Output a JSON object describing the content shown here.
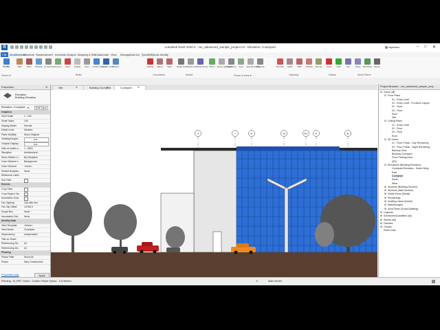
{
  "titlebar": {
    "title": "Autodesk Revit 2020.2 - rac_advanced_sample_project.rvt - Elevation: Courtyard",
    "user": "szpieska"
  },
  "menu": {
    "file": "File",
    "items": [
      "Architecture",
      "Structure",
      "Systems",
      "Insert",
      "Annotate",
      "Analyze",
      "Massing & Site",
      "Collaborate",
      "View",
      "Manage",
      "Add-Ins",
      "Quick",
      "BIMtools",
      "Modify"
    ]
  },
  "ribbon": {
    "modify": "Modify",
    "select": "Select ▾",
    "build_tools": [
      "Wall",
      "Door",
      "Window",
      "Component",
      "Column",
      "Roof",
      "Ceiling",
      "Floor",
      "Curtain System",
      "Curtain Grid",
      "Mullion"
    ],
    "circulation_tools": [
      "Railing",
      "Ramp",
      "Stair"
    ],
    "model_tools": [
      "Model Text",
      "Model Line",
      "Model Group"
    ],
    "room_tools": [
      "Room",
      "Room Separator",
      "Tag Room",
      "Area",
      "Area Boundary",
      "Tag Area"
    ],
    "opening_tools": [
      "By Face",
      "Shaft",
      "Wall",
      "Vertical",
      "Dormer"
    ],
    "datum_tools": [
      "Level",
      "Grid"
    ],
    "workplane_tools": [
      "Set",
      "Show",
      "Ref Plane",
      "Viewer"
    ],
    "panels": [
      "Build",
      "Circulation",
      "Model",
      "Room & Area ▾",
      "Opening",
      "Datum",
      "Work Plane"
    ]
  },
  "properties": {
    "title": "Properties",
    "type_name": "Elevation",
    "type_sub": "Building Elevation",
    "selector": "Elevation: Courtyard",
    "edit_type": "Edit Type",
    "rows": [
      {
        "k": "Graphics",
        "v": "",
        "grp": true
      },
      {
        "k": "View Scale",
        "v": "1 : 100"
      },
      {
        "k": "Scale Value",
        "v": "100"
      },
      {
        "k": "Display Model",
        "v": "Normal"
      },
      {
        "k": "Detail Level",
        "v": "Medium"
      },
      {
        "k": "Parts Visibility",
        "v": "Show Original"
      },
      {
        "k": "Visibility/Graphi...",
        "v": "Edit...",
        "btn": true
      },
      {
        "k": "Graphic Display ...",
        "v": "Edit...",
        "btn": true
      },
      {
        "k": "Hide at scales c...",
        "v": "1 : 5000"
      },
      {
        "k": "Discipline",
        "v": "Architectural"
      },
      {
        "k": "Show Hidden Li...",
        "v": "By Discipline"
      },
      {
        "k": "Color Scheme L...",
        "v": "Background"
      },
      {
        "k": "Color Scheme",
        "v": "<none>"
      },
      {
        "k": "Default Analysis...",
        "v": "None"
      },
      {
        "k": "Reference Label",
        "v": ""
      },
      {
        "k": "Sun Path",
        "v": "",
        "cb": true
      },
      {
        "k": "Extents",
        "v": "",
        "grp": true
      },
      {
        "k": "Crop View",
        "v": "",
        "cb": true
      },
      {
        "k": "Crop Region Vis...",
        "v": "",
        "cb": true
      },
      {
        "k": "Annotation Crop",
        "v": "",
        "cb": true
      },
      {
        "k": "Far Clipping",
        "v": "Clip with line"
      },
      {
        "k": "Far Clip Offset",
        "v": "14756.3"
      },
      {
        "k": "Scope Box",
        "v": "None"
      },
      {
        "k": "Associated Dat...",
        "v": "None"
      },
      {
        "k": "Identity Data",
        "v": "",
        "grp": true
      },
      {
        "k": "View Template",
        "v": "<None>"
      },
      {
        "k": "View Name",
        "v": "Courtyard"
      },
      {
        "k": "Dependency",
        "v": "Independent"
      },
      {
        "k": "Title on Sheet",
        "v": ""
      },
      {
        "k": "Referencing Sh...",
        "v": "A1"
      },
      {
        "k": "Referencing De...",
        "v": "A1"
      },
      {
        "k": "Phasing",
        "v": "",
        "grp": true
      },
      {
        "k": "Phase Filter",
        "v": "Show All"
      },
      {
        "k": "Phase",
        "v": "New Construction"
      }
    ],
    "help": "Properties help",
    "apply": "Apply"
  },
  "view_tabs": [
    {
      "label": "Site",
      "active": false
    },
    {
      "label": "Building Courtyard",
      "active": false
    },
    {
      "label": "Courtyard",
      "active": true
    }
  ],
  "grid_labels": [
    "J",
    "I",
    "H",
    "G",
    "F1",
    "F",
    "E"
  ],
  "view_control": {
    "scale": "1 : 100"
  },
  "project_browser": {
    "title": "Project Browser - rac_advanced_sample_proj...",
    "items": [
      {
        "t": "Views (all)",
        "d": 0,
        "exp": "-"
      },
      {
        "t": "Floor Plans",
        "d": 1,
        "exp": "-"
      },
      {
        "t": "01 - Entry Level",
        "d": 2
      },
      {
        "t": "01 - Entry Level - Furniture Layout",
        "d": 2
      },
      {
        "t": "02 - Floor",
        "d": 2
      },
      {
        "t": "03 - Floor",
        "d": 2
      },
      {
        "t": "Roof",
        "d": 2
      },
      {
        "t": "Site",
        "d": 2
      },
      {
        "t": "Ceiling Plans",
        "d": 1,
        "exp": "-"
      },
      {
        "t": "01 - Entry Level",
        "d": 2
      },
      {
        "t": "02 - Floor",
        "d": 2
      },
      {
        "t": "03 - Floor",
        "d": 2
      },
      {
        "t": "Roof",
        "d": 2
      },
      {
        "t": "3D Views",
        "d": 1,
        "exp": "-"
      },
      {
        "t": "01 - Floor Public - Day Rendering",
        "d": 2
      },
      {
        "t": "03 - Floor Public - Night Rendering",
        "d": 2
      },
      {
        "t": "Balcony View",
        "d": 2
      },
      {
        "t": "Building Courtyard",
        "d": 2
      },
      {
        "t": "From Parking Area",
        "d": 2
      },
      {
        "t": "{3D}",
        "d": 2
      },
      {
        "t": "Elevations (Building Elevation)",
        "d": 1,
        "exp": "-"
      },
      {
        "t": "Courtyard Elevation - South Wing",
        "d": 2
      },
      {
        "t": "East",
        "d": 2
      },
      {
        "t": "Courtyard",
        "d": 2,
        "sel": true
      },
      {
        "t": "South",
        "d": 2
      },
      {
        "t": "West",
        "d": 2
      },
      {
        "t": "Sections (Building Section)",
        "d": 1,
        "exp": "+"
      },
      {
        "t": "Sections (Wall Section)",
        "d": 1,
        "exp": "+"
      },
      {
        "t": "Detail Views (Detail)",
        "d": 1,
        "exp": "+"
      },
      {
        "t": "Renderings",
        "d": 1,
        "exp": "+"
      },
      {
        "t": "Drafting Views (Detail)",
        "d": 1,
        "exp": "+"
      },
      {
        "t": "Walkthroughs",
        "d": 1,
        "exp": "+"
      },
      {
        "t": "Area Plans (Gross Building)",
        "d": 1,
        "exp": "+"
      },
      {
        "t": "Legends",
        "d": 0,
        "exp": "+"
      },
      {
        "t": "Schedules/Quantities (all)",
        "d": 0,
        "exp": "+"
      },
      {
        "t": "Sheets (all)",
        "d": 0,
        "exp": "+"
      },
      {
        "t": "Families",
        "d": 0,
        "exp": "+"
      },
      {
        "t": "Groups",
        "d": 0,
        "exp": "+"
      },
      {
        "t": "Revit Links",
        "d": 0,
        "exp": ""
      }
    ]
  },
  "status": {
    "text": "Planting : M_RPC Shrub : Golden Flame Spirea - 0.6 Meters",
    "model": "Main Model",
    "zero": ":0"
  }
}
